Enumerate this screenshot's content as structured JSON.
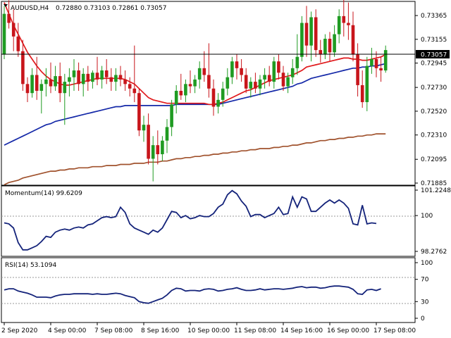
{
  "header": {
    "symbol": "AUDUSD,H4",
    "ohlc": "0.72880 0.73103 0.72861 0.73057",
    "dropdown_icon": "triangle-down-icon"
  },
  "colors": {
    "bull": "#1f9b22",
    "bear": "#c8151b",
    "sma_fast": "#e0191c",
    "sma_mid": "#1428a8",
    "sma_slow": "#a0522d",
    "indicator": "#14237a",
    "price_tag_bg": "#000000",
    "grid": "#cfcfcf"
  },
  "chart_data": [
    {
      "type": "candlestick",
      "title": "AUDUSD,H4",
      "ylim": [
        0.71885,
        0.73465
      ],
      "yticks": [
        "0.73365",
        "0.73155",
        "0.72945",
        "0.72730",
        "0.72520",
        "0.72310",
        "0.72095",
        "0.71885"
      ],
      "current_price": "0.73057",
      "x_labels": [
        "2 Sep 2020",
        "4 Sep 00:00",
        "7 Sep 08:00",
        "8 Sep 16:00",
        "10 Sep 00:00",
        "11 Sep 08:00",
        "14 Sep 16:00",
        "16 Sep 00:00",
        "17 Sep 08:00"
      ],
      "x_label_index": [
        0,
        10,
        20,
        30,
        40,
        50,
        60,
        70,
        80
      ],
      "candles": [
        [
          0.7302,
          0.7345,
          0.7298,
          0.7338
        ],
        [
          0.7338,
          0.735,
          0.7325,
          0.733
        ],
        [
          0.733,
          0.7342,
          0.7305,
          0.7318
        ],
        [
          0.7318,
          0.733,
          0.73,
          0.7305
        ],
        [
          0.7305,
          0.7315,
          0.727,
          0.7276
        ],
        [
          0.7276,
          0.7282,
          0.726,
          0.7268
        ],
        [
          0.7268,
          0.729,
          0.7264,
          0.7284
        ],
        [
          0.7284,
          0.73,
          0.7262,
          0.727
        ],
        [
          0.727,
          0.728,
          0.725,
          0.7276
        ],
        [
          0.7276,
          0.729,
          0.7265,
          0.728
        ],
        [
          0.728,
          0.7295,
          0.7268,
          0.7274
        ],
        [
          0.7274,
          0.7292,
          0.727,
          0.7283
        ],
        [
          0.7283,
          0.7295,
          0.726,
          0.7268
        ],
        [
          0.7268,
          0.7285,
          0.724,
          0.7278
        ],
        [
          0.7278,
          0.729,
          0.7265,
          0.7282
        ],
        [
          0.7282,
          0.7298,
          0.727,
          0.7288
        ],
        [
          0.7288,
          0.7295,
          0.727,
          0.7276
        ],
        [
          0.7276,
          0.729,
          0.7265,
          0.7285
        ],
        [
          0.7285,
          0.7292,
          0.727,
          0.7278
        ],
        [
          0.7278,
          0.7288,
          0.7272,
          0.7286
        ],
        [
          0.7286,
          0.73,
          0.7275,
          0.728
        ],
        [
          0.728,
          0.7292,
          0.7272,
          0.7288
        ],
        [
          0.7288,
          0.7298,
          0.7276,
          0.7282
        ],
        [
          0.7282,
          0.729,
          0.727,
          0.7278
        ],
        [
          0.7278,
          0.729,
          0.727,
          0.7284
        ],
        [
          0.7284,
          0.7292,
          0.7274,
          0.728
        ],
        [
          0.728,
          0.7288,
          0.727,
          0.7276
        ],
        [
          0.7276,
          0.7282,
          0.7265,
          0.7272
        ],
        [
          0.7272,
          0.731,
          0.726,
          0.7268
        ],
        [
          0.7268,
          0.7272,
          0.723,
          0.7235
        ],
        [
          0.7235,
          0.7248,
          0.7225,
          0.724
        ],
        [
          0.724,
          0.725,
          0.7205,
          0.721
        ],
        [
          0.721,
          0.723,
          0.719,
          0.7222
        ],
        [
          0.7222,
          0.7235,
          0.7205,
          0.7214
        ],
        [
          0.7214,
          0.723,
          0.7208,
          0.7226
        ],
        [
          0.7226,
          0.7245,
          0.7215,
          0.7238
        ],
        [
          0.7238,
          0.7262,
          0.723,
          0.7258
        ],
        [
          0.7258,
          0.7275,
          0.725,
          0.727
        ],
        [
          0.727,
          0.7285,
          0.7262,
          0.7266
        ],
        [
          0.7266,
          0.728,
          0.726,
          0.7276
        ],
        [
          0.7276,
          0.7288,
          0.7268,
          0.7274
        ],
        [
          0.7274,
          0.7284,
          0.7268,
          0.728
        ],
        [
          0.728,
          0.7296,
          0.7272,
          0.729
        ],
        [
          0.729,
          0.7305,
          0.7278,
          0.7284
        ],
        [
          0.7284,
          0.7312,
          0.7264,
          0.7272
        ],
        [
          0.7272,
          0.728,
          0.7248,
          0.7256
        ],
        [
          0.7256,
          0.7268,
          0.725,
          0.7262
        ],
        [
          0.7262,
          0.7278,
          0.7256,
          0.7272
        ],
        [
          0.7272,
          0.729,
          0.7266,
          0.7282
        ],
        [
          0.7282,
          0.73,
          0.7276,
          0.7296
        ],
        [
          0.7296,
          0.7302,
          0.728,
          0.729
        ],
        [
          0.729,
          0.7298,
          0.7278,
          0.7284
        ],
        [
          0.7284,
          0.729,
          0.7268,
          0.7272
        ],
        [
          0.7272,
          0.7282,
          0.7264,
          0.7278
        ],
        [
          0.7278,
          0.7286,
          0.7268,
          0.7272
        ],
        [
          0.7272,
          0.7284,
          0.7266,
          0.728
        ],
        [
          0.728,
          0.729,
          0.7272,
          0.7284
        ],
        [
          0.7284,
          0.7292,
          0.7274,
          0.7278
        ],
        [
          0.7278,
          0.73,
          0.7272,
          0.7296
        ],
        [
          0.7296,
          0.7302,
          0.728,
          0.7286
        ],
        [
          0.7286,
          0.7292,
          0.727,
          0.7274
        ],
        [
          0.7274,
          0.7286,
          0.7268,
          0.7282
        ],
        [
          0.7282,
          0.7298,
          0.7276,
          0.729
        ],
        [
          0.729,
          0.732,
          0.7284,
          0.73
        ],
        [
          0.73,
          0.7336,
          0.7296,
          0.733
        ],
        [
          0.733,
          0.7345,
          0.73,
          0.731
        ],
        [
          0.731,
          0.734,
          0.7296,
          0.7335
        ],
        [
          0.7335,
          0.7342,
          0.73,
          0.7306
        ],
        [
          0.7306,
          0.7315,
          0.7295,
          0.7302
        ],
        [
          0.7302,
          0.732,
          0.7298,
          0.7316
        ],
        [
          0.7316,
          0.7322,
          0.7296,
          0.7304
        ],
        [
          0.7304,
          0.7328,
          0.73,
          0.732
        ],
        [
          0.732,
          0.7342,
          0.7312,
          0.7336
        ],
        [
          0.7336,
          0.7352,
          0.7318,
          0.733
        ],
        [
          0.733,
          0.7348,
          0.7315,
          0.7328
        ],
        [
          0.7328,
          0.734,
          0.7296,
          0.7302
        ],
        [
          0.7302,
          0.7312,
          0.7265,
          0.7275
        ],
        [
          0.7275,
          0.7288,
          0.7255,
          0.726
        ],
        [
          0.726,
          0.73,
          0.7252,
          0.7292
        ],
        [
          0.7292,
          0.7308,
          0.7285,
          0.7298
        ],
        [
          0.7298,
          0.7305,
          0.7282,
          0.729
        ],
        [
          0.729,
          0.73,
          0.7278,
          0.7288
        ],
        [
          0.7288,
          0.731,
          0.7286,
          0.7306
        ]
      ],
      "series": [
        {
          "role": "sma_fast",
          "values": [
            0.7348,
            0.7338,
            0.7328,
            0.732,
            0.7312,
            0.7304,
            0.7298,
            0.7292,
            0.7287,
            0.7283,
            0.728,
            0.7278,
            0.7276,
            0.7275,
            0.7275,
            0.7276,
            0.7277,
            0.7278,
            0.7279,
            0.728,
            0.7281,
            0.7281,
            0.7281,
            0.7281,
            0.7281,
            0.7281,
            0.728,
            0.7278,
            0.7276,
            0.7272,
            0.7268,
            0.7264,
            0.7262,
            0.7261,
            0.726,
            0.7259,
            0.7259,
            0.7259,
            0.7259,
            0.7259,
            0.7259,
            0.7259,
            0.7259,
            0.7259,
            0.7258,
            0.7258,
            0.7259,
            0.726,
            0.7262,
            0.7264,
            0.7266,
            0.7268,
            0.727,
            0.7271,
            0.7273,
            0.7275,
            0.7277,
            0.7279,
            0.728,
            0.7281,
            0.7282,
            0.7283,
            0.7284,
            0.7286,
            0.7288,
            0.7291,
            0.7292,
            0.7293,
            0.7294,
            0.7295,
            0.7296,
            0.7297,
            0.7298,
            0.7299,
            0.7299,
            0.7298,
            0.7298,
            0.7297,
            0.7297,
            0.7298,
            0.7299,
            0.73,
            0.7302
          ]
        },
        {
          "role": "sma_mid",
          "values": [
            0.7222,
            0.7224,
            0.7226,
            0.7228,
            0.723,
            0.7232,
            0.7234,
            0.7236,
            0.7238,
            0.724,
            0.7241,
            0.7243,
            0.7244,
            0.7245,
            0.7246,
            0.7247,
            0.7248,
            0.7249,
            0.725,
            0.7251,
            0.7252,
            0.7253,
            0.7254,
            0.7255,
            0.7256,
            0.7256,
            0.7257,
            0.7257,
            0.7257,
            0.7257,
            0.7257,
            0.7257,
            0.7257,
            0.7257,
            0.7257,
            0.7257,
            0.7257,
            0.7258,
            0.7258,
            0.7258,
            0.7258,
            0.7258,
            0.7258,
            0.7258,
            0.7258,
            0.7258,
            0.7258,
            0.7259,
            0.726,
            0.7261,
            0.7262,
            0.7263,
            0.7264,
            0.7265,
            0.7266,
            0.7267,
            0.7268,
            0.7269,
            0.727,
            0.7271,
            0.7272,
            0.7273,
            0.7274,
            0.7276,
            0.7277,
            0.7279,
            0.7281,
            0.7282,
            0.7283,
            0.7284,
            0.7285,
            0.7286,
            0.7287,
            0.7288,
            0.7289,
            0.729,
            0.729,
            0.7291,
            0.7291,
            0.7292,
            0.7292,
            0.7293,
            0.7294
          ]
        },
        {
          "role": "sma_slow",
          "values": [
            0.7187,
            0.7189,
            0.719,
            0.7191,
            0.7193,
            0.7194,
            0.7195,
            0.7196,
            0.7197,
            0.7198,
            0.7199,
            0.7199,
            0.72,
            0.72,
            0.7201,
            0.7201,
            0.7202,
            0.7202,
            0.7202,
            0.7203,
            0.7203,
            0.7203,
            0.7204,
            0.7204,
            0.7204,
            0.7205,
            0.7205,
            0.7205,
            0.7206,
            0.7206,
            0.7206,
            0.7207,
            0.7207,
            0.7207,
            0.7208,
            0.7208,
            0.7209,
            0.721,
            0.721,
            0.7211,
            0.7211,
            0.7212,
            0.7212,
            0.7213,
            0.7213,
            0.7214,
            0.7214,
            0.7215,
            0.7215,
            0.7216,
            0.7216,
            0.7217,
            0.7217,
            0.7218,
            0.7218,
            0.7219,
            0.7219,
            0.7219,
            0.722,
            0.722,
            0.7221,
            0.7221,
            0.7222,
            0.7222,
            0.7223,
            0.7224,
            0.7224,
            0.7225,
            0.7226,
            0.7226,
            0.7227,
            0.7227,
            0.7228,
            0.7228,
            0.7229,
            0.7229,
            0.723,
            0.723,
            0.7231,
            0.7231,
            0.7232,
            0.7232,
            0.7232
          ]
        }
      ]
    },
    {
      "type": "line",
      "title": "Momentum(14) 99.6209",
      "ylim": [
        98.2762,
        101.2248
      ],
      "yticks": [
        "101.2248",
        "100",
        "98.2762"
      ],
      "reference_level": 100,
      "series": [
        {
          "role": "momentum",
          "values": [
            99.65,
            99.6,
            99.4,
            98.7,
            98.35,
            98.35,
            98.45,
            98.55,
            98.75,
            99.0,
            98.95,
            99.2,
            99.3,
            99.35,
            99.3,
            99.4,
            99.45,
            99.4,
            99.55,
            99.6,
            99.75,
            99.9,
            99.95,
            99.9,
            99.95,
            100.4,
            100.15,
            99.6,
            99.4,
            99.3,
            99.2,
            99.1,
            99.3,
            99.2,
            99.4,
            99.8,
            100.2,
            100.15,
            99.9,
            100.0,
            99.85,
            99.9,
            100.0,
            99.95,
            99.95,
            100.1,
            100.4,
            100.55,
            101.0,
            101.2,
            101.05,
            100.7,
            100.45,
            99.95,
            100.05,
            100.05,
            99.9,
            100.0,
            100.1,
            100.4,
            100.05,
            100.1,
            100.9,
            100.4,
            100.9,
            100.8,
            100.2,
            100.2,
            100.4,
            100.6,
            100.75,
            100.6,
            100.75,
            100.6,
            100.35,
            99.6,
            99.55,
            100.5,
            99.6,
            99.65,
            99.62
          ]
        }
      ]
    },
    {
      "type": "line",
      "title": "RSI(14) 53.1094",
      "ylim": [
        0,
        100
      ],
      "yticks": [
        "100",
        "70",
        "30",
        "0"
      ],
      "reference_levels": [
        70,
        30
      ],
      "series": [
        {
          "role": "rsi",
          "values": [
            51,
            53,
            53,
            49,
            47,
            45,
            42,
            38,
            38,
            38,
            37,
            40,
            42,
            43,
            43,
            44,
            44,
            44,
            44,
            43,
            44,
            43,
            43,
            44,
            45,
            44,
            41,
            39,
            37,
            30,
            28,
            27,
            30,
            33,
            36,
            42,
            50,
            54,
            53,
            49,
            50,
            50,
            49,
            52,
            53,
            52,
            49,
            50,
            52,
            53,
            55,
            52,
            50,
            50,
            51,
            53,
            51,
            52,
            53,
            53,
            52,
            53,
            54,
            56,
            57,
            55,
            56,
            56,
            54,
            55,
            57,
            58,
            58,
            57,
            56,
            52,
            44,
            43,
            51,
            52,
            50,
            53
          ]
        }
      ]
    }
  ]
}
